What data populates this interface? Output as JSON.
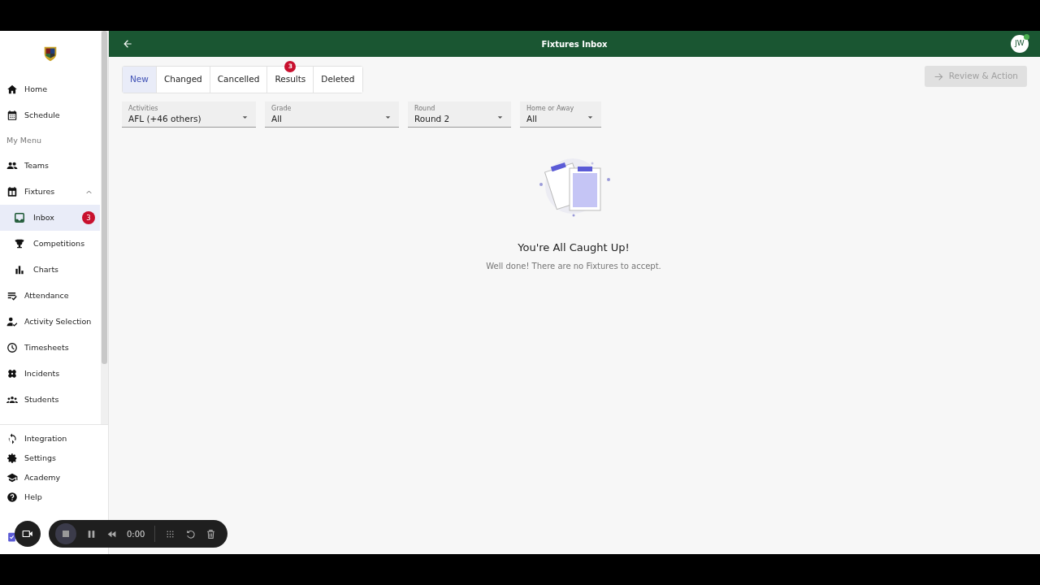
{
  "sidebar": {
    "items": [
      {
        "label": "Home",
        "selected": false
      },
      {
        "label": "Schedule",
        "selected": false
      }
    ],
    "section_title": "My Menu",
    "menu": [
      {
        "label": "Teams",
        "selected": false
      },
      {
        "label": "Fixtures",
        "selected": false,
        "expanded": true,
        "children": [
          {
            "label": "Inbox",
            "selected": true,
            "badge": "3"
          },
          {
            "label": "Competitions",
            "selected": false
          },
          {
            "label": "Charts",
            "selected": false
          }
        ]
      },
      {
        "label": "Attendance",
        "selected": false
      },
      {
        "label": "Activity Selection",
        "selected": false
      },
      {
        "label": "Timesheets",
        "selected": false
      },
      {
        "label": "Incidents",
        "selected": false
      },
      {
        "label": "Students",
        "selected": false
      }
    ],
    "bottom_items": [
      {
        "label": "Integration"
      },
      {
        "label": "Settings"
      },
      {
        "label": "Academy"
      },
      {
        "label": "Help"
      }
    ]
  },
  "header": {
    "title": "Fixtures Inbox",
    "avatar": "JW",
    "online": true
  },
  "tabs": [
    {
      "label": "New",
      "selected": true
    },
    {
      "label": "Changed",
      "selected": false
    },
    {
      "label": "Cancelled",
      "selected": false
    },
    {
      "label": "Results",
      "selected": false,
      "badge": "3"
    },
    {
      "label": "Deleted",
      "selected": false
    }
  ],
  "action_button": {
    "label": "Review & Action",
    "disabled": true
  },
  "filters": [
    {
      "label": "Activities",
      "value": "AFL (+46 others)"
    },
    {
      "label": "Grade",
      "value": "All"
    },
    {
      "label": "Round",
      "value": "Round 2"
    },
    {
      "label": "Home or Away",
      "value": "All"
    }
  ],
  "empty_state": {
    "title": "You're All Caught Up!",
    "message": "Well done! There are no Fixtures to accept."
  },
  "recorder": {
    "time": "0:00"
  }
}
